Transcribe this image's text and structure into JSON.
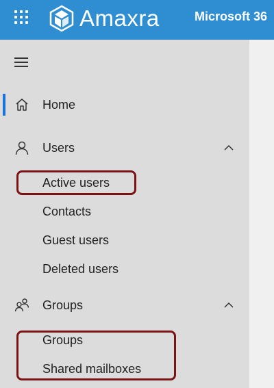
{
  "header": {
    "brand_name": "Amaxra",
    "product_title": "Microsoft 36"
  },
  "nav": {
    "home": {
      "label": "Home",
      "icon": "home-icon"
    },
    "users": {
      "label": "Users",
      "icon": "person-icon",
      "expanded": true,
      "children": [
        {
          "label": "Active users",
          "highlighted": true
        },
        {
          "label": "Contacts"
        },
        {
          "label": "Guest users"
        },
        {
          "label": "Deleted users"
        }
      ]
    },
    "groups": {
      "label": "Groups",
      "icon": "people-icon",
      "expanded": true,
      "children": [
        {
          "label": "Groups",
          "highlighted": true
        },
        {
          "label": "Shared mailboxes",
          "highlighted": true
        }
      ]
    }
  },
  "colors": {
    "topbar": "#2f8ed1",
    "nav_background": "#dcdcdc",
    "active_indicator": "#1a73d9",
    "highlight_border": "#7a1414"
  }
}
